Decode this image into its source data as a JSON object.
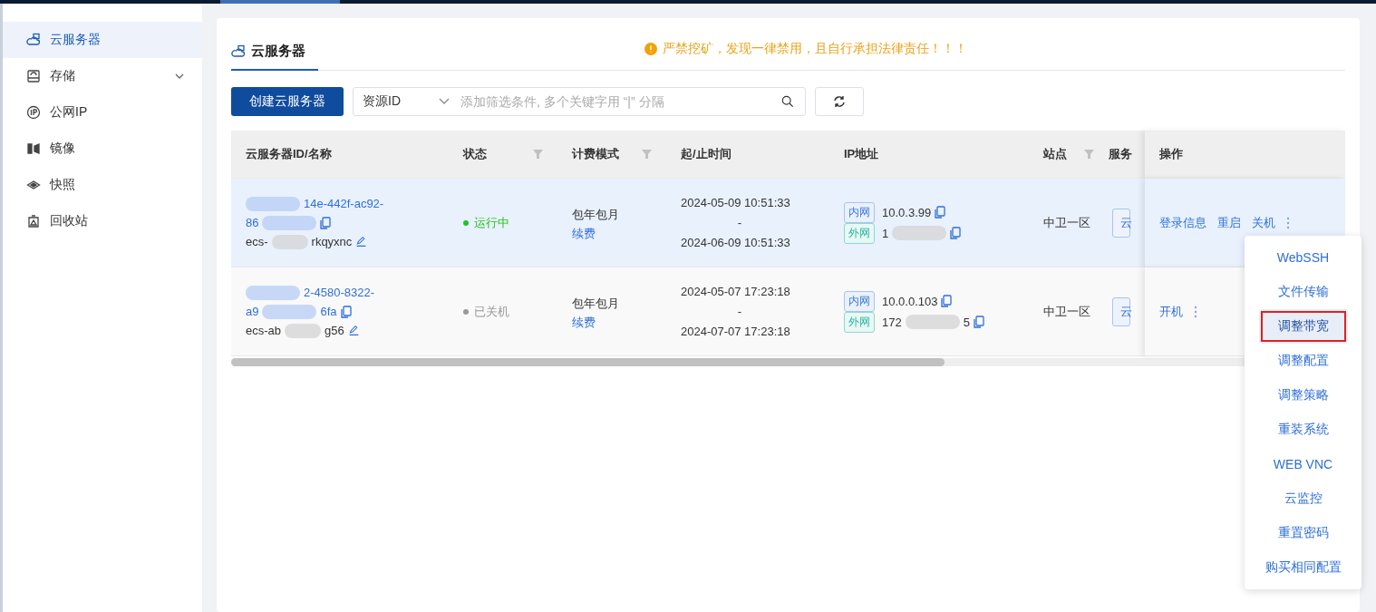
{
  "sidebar": {
    "items": [
      {
        "label": "云服务器",
        "kind": "cloud",
        "selected": true,
        "has_submenu": false
      },
      {
        "label": "存储",
        "kind": "drive",
        "selected": false,
        "has_submenu": true
      },
      {
        "label": "公网IP",
        "kind": "ip",
        "selected": false,
        "has_submenu": false
      },
      {
        "label": "镜像",
        "kind": "mirror",
        "selected": false,
        "has_submenu": false
      },
      {
        "label": "快照",
        "kind": "layers",
        "selected": false,
        "has_submenu": false
      },
      {
        "label": "回收站",
        "kind": "bin",
        "selected": false,
        "has_submenu": false
      }
    ]
  },
  "page": {
    "tab": "云服务器",
    "notice": "严禁挖矿，发现一律禁用，且自行承担法律责任！！！"
  },
  "toolbar": {
    "create_button": "创建云服务器",
    "filter_key": "资源ID",
    "search": {
      "placeholder": "添加筛选条件, 多个关键字用 “|” 分隔"
    }
  },
  "table": {
    "columns": [
      {
        "label": "云服务器ID/名称",
        "filter": false
      },
      {
        "label": "状态",
        "filter": true
      },
      {
        "label": "计费模式",
        "filter": true
      },
      {
        "label": "起/止时间",
        "filter": false
      },
      {
        "label": "IP地址",
        "filter": false
      },
      {
        "label": "站点",
        "filter": true
      },
      {
        "label": "服务",
        "filter": false
      },
      {
        "label": "操作",
        "filter": false
      }
    ],
    "rows": [
      {
        "highlighted": true,
        "id_lines": [
          [
            {
              "kind": "redacted"
            },
            {
              "kind": "text",
              "text": "14e-442f-ac92-"
            }
          ],
          [
            {
              "kind": "text",
              "text": "86"
            },
            {
              "kind": "redacted"
            }
          ]
        ],
        "name": [
          {
            "kind": "text",
            "text": "ecs-"
          },
          {
            "kind": "redacted"
          },
          {
            "kind": "text",
            "text": "rkqyxnc"
          }
        ],
        "status": {
          "label": "运行中",
          "kind": "running"
        },
        "billing": "包年包月",
        "renew": "续费",
        "start": "2024-05-09 10:51:33",
        "separator": "-",
        "end": "2024-06-09 10:51:33",
        "ips": [
          {
            "tag": "内网",
            "kind": "private",
            "parts": [
              {
                "kind": "text",
                "text": "10.0.3.99"
              }
            ]
          },
          {
            "tag": "外网",
            "kind": "public",
            "parts": [
              {
                "kind": "text",
                "text": "1"
              },
              {
                "kind": "redacted"
              }
            ]
          }
        ],
        "site": "中卫一区",
        "service": "云",
        "actions": [
          "登录信息",
          "重启",
          "关机"
        ]
      },
      {
        "highlighted": false,
        "id_lines": [
          [
            {
              "kind": "redacted"
            },
            {
              "kind": "text",
              "text": "2-4580-8322-"
            }
          ],
          [
            {
              "kind": "text",
              "text": "a9"
            },
            {
              "kind": "redacted"
            },
            {
              "kind": "text",
              "text": "6fa"
            }
          ]
        ],
        "name": [
          {
            "kind": "text",
            "text": "ecs-ab"
          },
          {
            "kind": "redacted"
          },
          {
            "kind": "text",
            "text": "g56"
          }
        ],
        "status": {
          "label": "已关机",
          "kind": "stopped"
        },
        "billing": "包年包月",
        "renew": "续费",
        "start": "2024-05-07 17:23:18",
        "separator": "-",
        "end": "2024-07-07 17:23:18",
        "ips": [
          {
            "tag": "内网",
            "kind": "private",
            "parts": [
              {
                "kind": "text",
                "text": "10.0.0.103"
              }
            ]
          },
          {
            "tag": "外网",
            "kind": "public",
            "parts": [
              {
                "kind": "text",
                "text": "172"
              },
              {
                "kind": "redacted"
              },
              {
                "kind": "text",
                "text": "5"
              }
            ]
          }
        ],
        "site": "中卫一区",
        "service": "云",
        "actions": [
          "开机"
        ]
      }
    ]
  },
  "menu": {
    "items": [
      {
        "label": "WebSSH",
        "selected": false
      },
      {
        "label": "文件传输",
        "selected": false
      },
      {
        "label": "调整带宽",
        "selected": true
      },
      {
        "label": "调整配置",
        "selected": false
      },
      {
        "label": "调整策略",
        "selected": false
      },
      {
        "label": "重装系统",
        "selected": false
      },
      {
        "label": "WEB VNC",
        "selected": false
      },
      {
        "label": "云监控",
        "selected": false
      },
      {
        "label": "重置密码",
        "selected": false
      },
      {
        "label": "购买相同配置",
        "selected": false
      }
    ]
  }
}
